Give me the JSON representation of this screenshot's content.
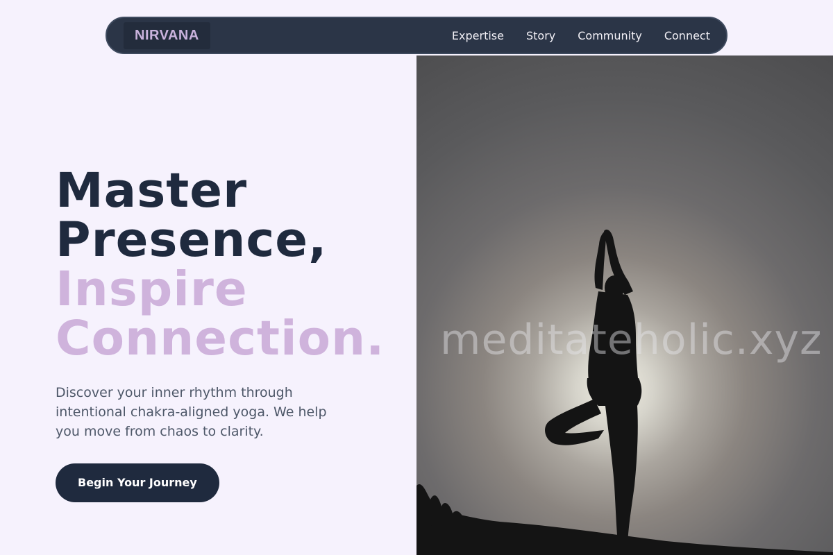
{
  "nav": {
    "logo": "NIRVANA",
    "links": [
      "Expertise",
      "Story",
      "Community",
      "Connect"
    ]
  },
  "hero": {
    "headline_dark": [
      "Master",
      "Presence,"
    ],
    "headline_light": [
      "Inspire",
      "Connection."
    ],
    "subtext": "Discover your inner rhythm through intentional chakra-aligned yoga. We help you move from chaos to clarity.",
    "cta_label": "Begin Your Journey"
  },
  "image": {
    "watermark": "meditateholic.xyz",
    "subject": "silhouette-of-person-in-tree-pose-at-sunset"
  },
  "colors": {
    "background": "#f6f2fd",
    "navbar": "#2b3547",
    "dark_text": "#1f2a3e",
    "accent_lavender": "#cfb3dc"
  }
}
